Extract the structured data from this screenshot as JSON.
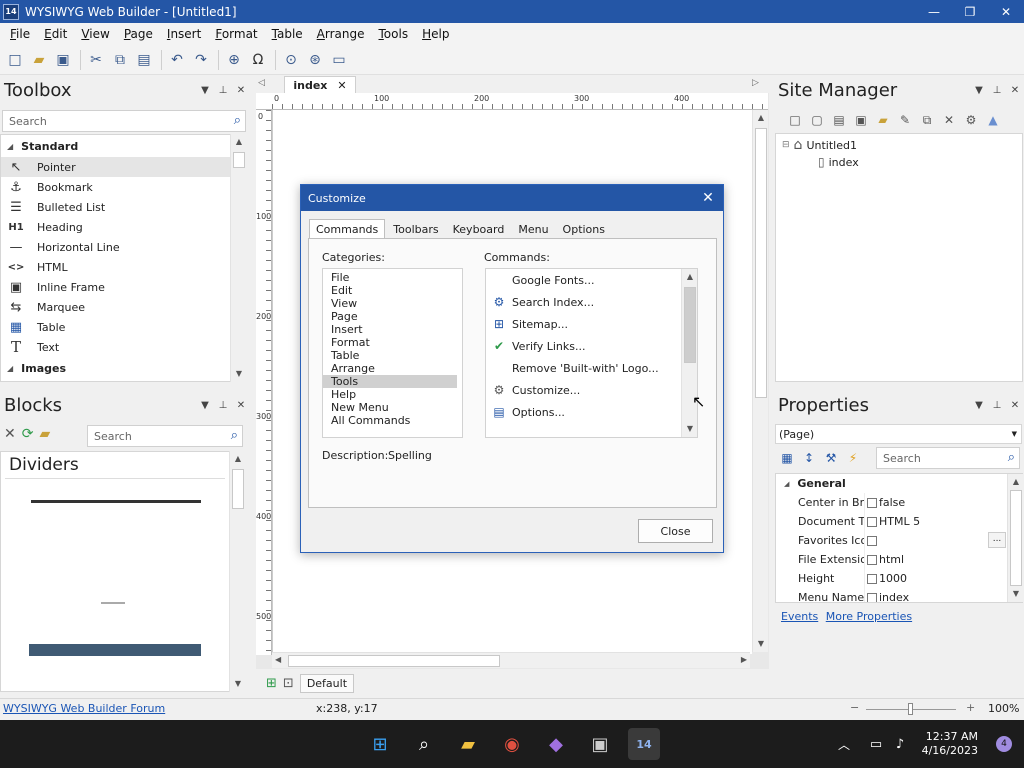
{
  "window": {
    "title": "WYSIWYG Web Builder - [Untitled1]",
    "app_icon_text": "14",
    "minimize": "—",
    "maximize": "❐",
    "close": "✕"
  },
  "menu": [
    "File",
    "Edit",
    "View",
    "Page",
    "Insert",
    "Format",
    "Table",
    "Arrange",
    "Tools",
    "Help"
  ],
  "toolbox": {
    "title": "Toolbox",
    "search_placeholder": "Search",
    "group_standard": "Standard",
    "items": [
      {
        "label": "Pointer",
        "icon": "↖"
      },
      {
        "label": "Bookmark",
        "icon": "⚓"
      },
      {
        "label": "Bulleted List",
        "icon": "☰"
      },
      {
        "label": "Heading",
        "icon": "H1"
      },
      {
        "label": "Horizontal Line",
        "icon": "—"
      },
      {
        "label": "HTML",
        "icon": "<>"
      },
      {
        "label": "Inline Frame",
        "icon": "▣"
      },
      {
        "label": "Marquee",
        "icon": "⇆"
      },
      {
        "label": "Table",
        "icon": "▦"
      },
      {
        "label": "Text",
        "icon": "T"
      }
    ],
    "group_images": "Images"
  },
  "blocks": {
    "title": "Blocks",
    "search_placeholder": "Search",
    "section": "Dividers"
  },
  "document": {
    "tab_label": "index",
    "ruler_h": [
      "0",
      "100",
      "200",
      "300",
      "400"
    ],
    "ruler_v": [
      "0",
      "100",
      "200",
      "300",
      "400",
      "500"
    ],
    "default_tab": "Default"
  },
  "dialog": {
    "title": "Customize",
    "tabs": [
      "Commands",
      "Toolbars",
      "Keyboard",
      "Menu",
      "Options"
    ],
    "categories_label": "Categories:",
    "commands_label": "Commands:",
    "categories": [
      "File",
      "Edit",
      "View",
      "Page",
      "Insert",
      "Format",
      "Table",
      "Arrange",
      "Tools",
      "Help",
      "New Menu",
      "All Commands"
    ],
    "selected_category": "Tools",
    "commands": [
      {
        "label": "Google Fonts...",
        "icon": ""
      },
      {
        "label": "Search Index...",
        "icon": "⚙"
      },
      {
        "label": "Sitemap...",
        "icon": "⊞"
      },
      {
        "label": "Verify Links...",
        "icon": "✔"
      },
      {
        "label": "Remove 'Built-with' Logo...",
        "icon": ""
      },
      {
        "label": "Customize...",
        "icon": "⚙"
      },
      {
        "label": "Options...",
        "icon": "▤"
      }
    ],
    "description_label": "Description:",
    "description_value": "Spelling",
    "close_button": "Close"
  },
  "site_manager": {
    "title": "Site Manager",
    "root": "Untitled1",
    "child": "index"
  },
  "properties": {
    "title": "Properties",
    "selector": "(Page)",
    "search_placeholder": "Search",
    "group": "General",
    "rows": [
      {
        "name": "Center in Bro...",
        "value": "false"
      },
      {
        "name": "Document Ty...",
        "value": "HTML 5"
      },
      {
        "name": "Favorites Icon",
        "value": ""
      },
      {
        "name": "File Extension",
        "value": "html"
      },
      {
        "name": "Height",
        "value": "1000"
      },
      {
        "name": "Menu Name",
        "value": "index"
      }
    ],
    "link_events": "Events",
    "link_more": "More Properties"
  },
  "status": {
    "forum_link": "WYSIWYG Web Builder Forum",
    "coords": "x:238, y:17",
    "zoom": "100%"
  },
  "taskbar": {
    "time": "12:37 AM",
    "date": "4/16/2023",
    "notifications": "4"
  }
}
